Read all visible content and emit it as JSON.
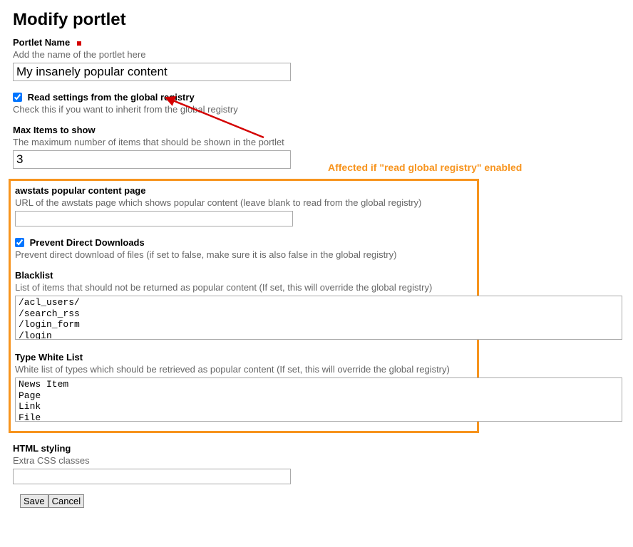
{
  "title": "Modify portlet",
  "annotation": {
    "caption": "Affected if \"read global registry\" enabled"
  },
  "fields": {
    "portletName": {
      "label": "Portlet Name",
      "help": "Add the name of the portlet here",
      "value": "My insanely popular content"
    },
    "readGlobal": {
      "label": "Read settings from the global registry",
      "help": "Check this if you want to inherit from the global registry",
      "checked": true
    },
    "maxItems": {
      "label": "Max Items to show",
      "help": "The maximum number of items that should be shown in the portlet",
      "value": "3"
    },
    "awstatsPage": {
      "label": "awstats popular content page",
      "help": "URL of the awstats page which shows popular content (leave blank to read from the global registry)",
      "value": ""
    },
    "preventDirect": {
      "label": "Prevent Direct Downloads",
      "help": "Prevent direct download of files (if set to false, make sure it is also false in the global registry)",
      "checked": true
    },
    "blacklist": {
      "label": "Blacklist",
      "help": "List of items that should not be returned as popular content (If set, this will override the global registry)",
      "value": "/acl_users/\n/search_rss\n/login_form\n/login"
    },
    "whitelist": {
      "label": "Type White List",
      "help": "White list of types which should be retrieved as popular content (If set, this will override the global registry)",
      "value": "News Item\nPage\nLink\nFile"
    },
    "htmlStyling": {
      "label": "HTML styling",
      "help": "Extra CSS classes",
      "value": ""
    }
  },
  "buttons": {
    "save": "Save",
    "cancel": "Cancel"
  }
}
